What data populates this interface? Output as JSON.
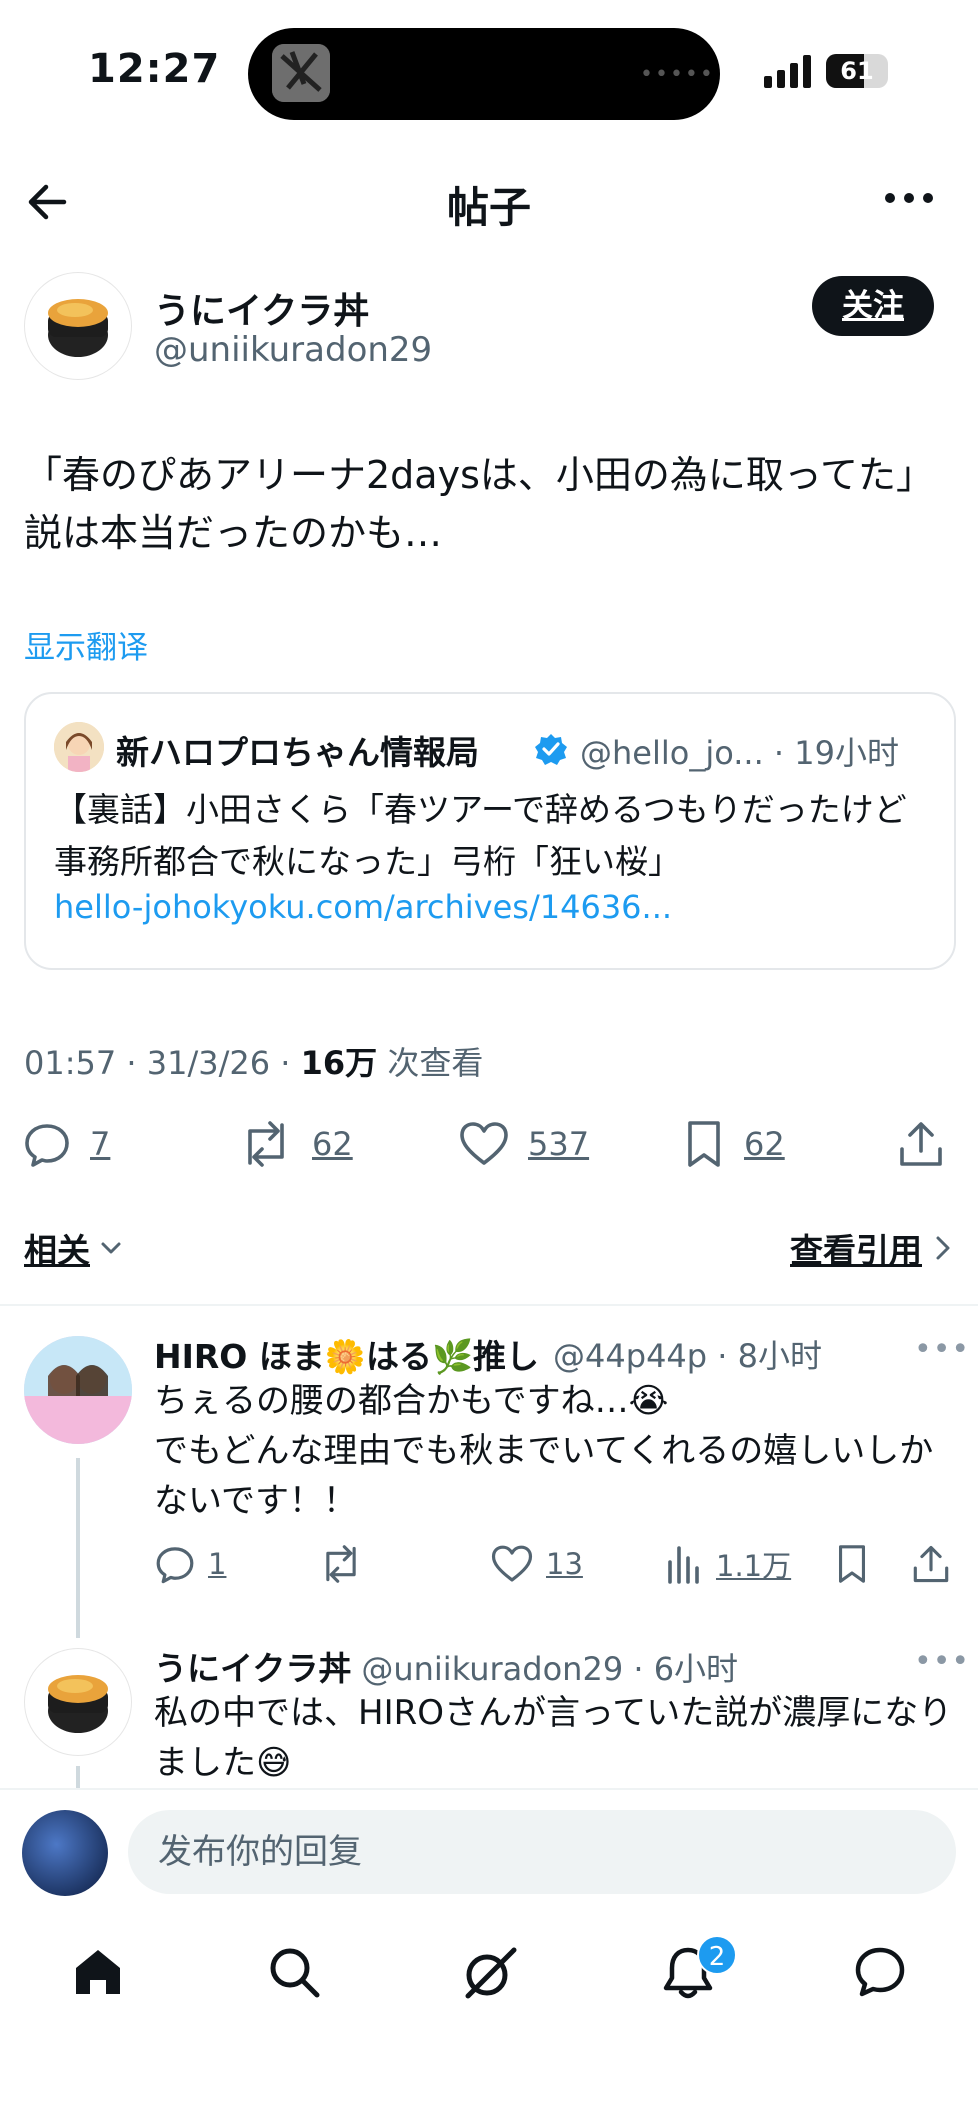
{
  "status_bar": {
    "time": "12:27",
    "battery": "61",
    "battery_level": 0.61,
    "island_dots": "•••••"
  },
  "header": {
    "title": "帖子",
    "back_icon": "arrow-left-icon",
    "more_icon": "more-horizontal-icon"
  },
  "post": {
    "author_name": "うにイクラ丼",
    "author_handle": "@uniikuradon29",
    "follow_label": "关注",
    "text": "「春のぴあアリーナ2daysは、小田の為に取ってた」説は本当だったのかも…",
    "translate_label": "显示翻译",
    "quote": {
      "name": "新ハロプロちゃん情報局",
      "meta": "@hello_jo... · 19小时",
      "text": "【裏話】小田さくら「春ツアーで辞めるつもりだったけど事務所都合で秋になった」弓桁「狂い桜」",
      "link": "hello-johokyoku.com/archives/14636..."
    },
    "meta_time": "01:57 · 31/3/26 · ",
    "meta_views": "16万",
    "meta_views_label": " 次查看",
    "actions": {
      "replies": "7",
      "reposts": "62",
      "likes": "537",
      "bookmarks": "62"
    },
    "related_label": "相关",
    "view_quotes_label": "查看引用"
  },
  "replies": [
    {
      "name": "HIRO ほま🌼はる🌿推し",
      "meta": "@44p44p · 8小时",
      "text": "ちぇるの腰の都合かもですね…😭\nでもどんな理由でも秋までいてくれるの嬉しいしかないです！！",
      "replies": "1",
      "likes": "13",
      "views": "1.1万",
      "more": "•••"
    },
    {
      "name": "うにイクラ丼",
      "meta": "@uniikuradon29 · 6小时",
      "text": "私の中では、HIROさんが言っていた説が濃厚になりました😅",
      "more": "•••"
    }
  ],
  "composer": {
    "placeholder": "发布你的回复"
  },
  "tab_bar": {
    "notifications_badge": "2",
    "icons": [
      "home-icon",
      "search-icon",
      "grok-icon",
      "bell-icon",
      "chat-icon"
    ]
  },
  "colors": {
    "accent": "#1d9bf0",
    "text": "#0f1419",
    "muted": "#536471"
  }
}
